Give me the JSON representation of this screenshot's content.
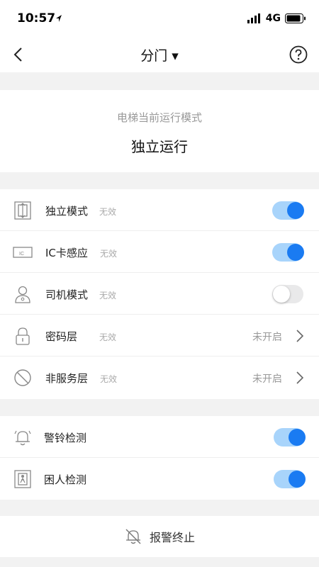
{
  "status_bar": {
    "time": "10:57",
    "network": "4G"
  },
  "nav": {
    "title": "分门 ▾"
  },
  "mode": {
    "label": "电梯当前运行模式",
    "value": "独立运行"
  },
  "rows": [
    {
      "label": "独立模式",
      "sub": "无效",
      "toggle": "on"
    },
    {
      "label": "IC卡感应",
      "sub": "无效",
      "toggle": "on"
    },
    {
      "label": "司机模式",
      "sub": "无效",
      "toggle": "off"
    },
    {
      "label": "密码层",
      "sub": "无效",
      "status": "未开启"
    },
    {
      "label": "非服务层",
      "sub": "无效",
      "status": "未开启"
    },
    {
      "label": "警铃检测",
      "toggle": "on"
    },
    {
      "label": "困人检测",
      "toggle": "on"
    }
  ],
  "alarm": {
    "label": "报警终止"
  },
  "colors": {
    "toggle_on": "#1a7bf2",
    "toggle_track_on": "#a8d4fb",
    "background": "#f2f2f2"
  }
}
